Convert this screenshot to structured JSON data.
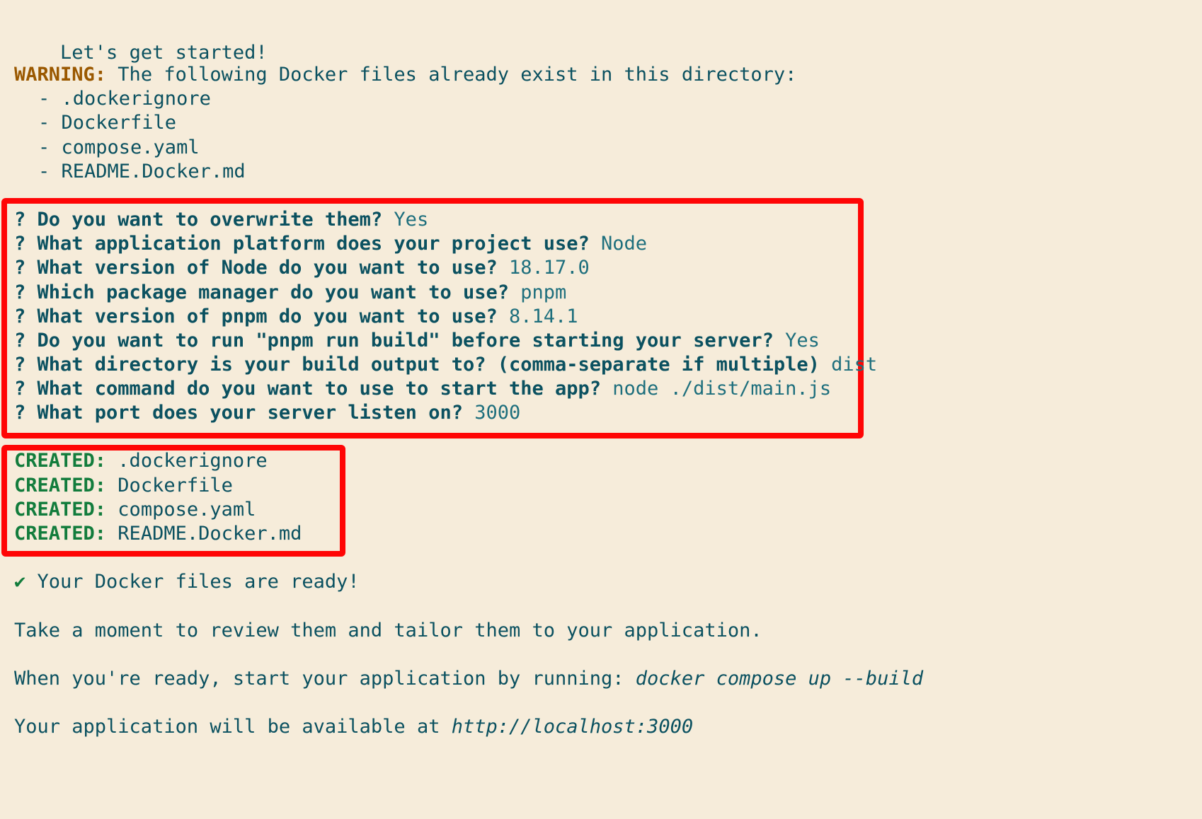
{
  "intro": "Let's get started!",
  "warning": {
    "label": "WARNING:",
    "text": " The following Docker files already exist in this directory:",
    "files": [
      "- .dockerignore",
      "- Dockerfile",
      "- compose.yaml",
      "- README.Docker.md"
    ]
  },
  "prompts": [
    {
      "q": "? Do you want to overwrite them?",
      "a": " Yes"
    },
    {
      "q": "? What application platform does your project use?",
      "a": " Node"
    },
    {
      "q": "? What version of Node do you want to use?",
      "a": " 18.17.0"
    },
    {
      "q": "? Which package manager do you want to use?",
      "a": " pnpm"
    },
    {
      "q": "? What version of pnpm do you want to use?",
      "a": " 8.14.1"
    },
    {
      "q": "? Do you want to run \"pnpm run build\" before starting your server?",
      "a": " Yes"
    },
    {
      "q": "? What directory is your build output to? (comma-separate if multiple)",
      "a": " dist"
    },
    {
      "q": "? What command do you want to use to start the app?",
      "a": " node ./dist/main.js"
    },
    {
      "q": "? What port does your server listen on?",
      "a": " 3000"
    }
  ],
  "created": [
    {
      "label": "CREATED:",
      "file": " .dockerignore"
    },
    {
      "label": "CREATED:",
      "file": " Dockerfile"
    },
    {
      "label": "CREATED:",
      "file": " compose.yaml"
    },
    {
      "label": "CREATED:",
      "file": " README.Docker.md"
    }
  ],
  "ready": {
    "check": "✔",
    "text": " Your Docker files are ready!"
  },
  "review": "Take a moment to review them and tailor them to your application.",
  "run": {
    "text": "When you're ready, start your application by running: ",
    "command": "docker compose up --build"
  },
  "available": {
    "text": "Your application will be available at ",
    "url": "http://localhost:3000"
  },
  "colors": {
    "background": "#f6ecda",
    "text": "#0b5160",
    "warning": "#9a5800",
    "created": "#127c3c",
    "highlight": "#ff0505"
  }
}
